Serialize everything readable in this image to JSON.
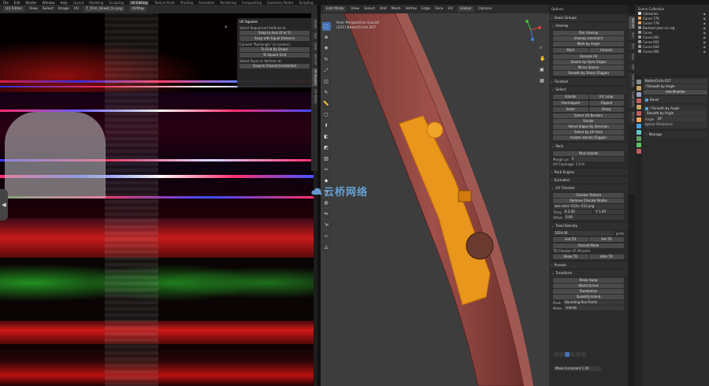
{
  "topbar": {
    "menu": [
      "File",
      "Edit",
      "Render",
      "Window",
      "Help"
    ],
    "workspaces": [
      "Layout",
      "Modeling",
      "Sculpting",
      "UV Editing",
      "Texture Paint",
      "Shading",
      "Animation",
      "Rendering",
      "Compositing",
      "Geometry Nodes",
      "Scripting"
    ],
    "active_workspace": "UV Editing"
  },
  "uv_editor": {
    "header": [
      "UV Editor",
      "View",
      "Select",
      "Image",
      "UV"
    ],
    "image_name": "T_Trim_Sheet_ts.png",
    "uvmap": "UVMap",
    "vertical_tabs": [
      "Image",
      "Tool",
      "View",
      "Zen UV",
      "UV Squares",
      "UV Toolkit"
    ],
    "active_tab": "UV Squares",
    "panel": {
      "title": "UV Squares",
      "sequential_label": "Select Sequenced Vertices to:",
      "snap_axis": "Snap to Axis (X or Y)",
      "snap_equal": "Snap with Equal Distance",
      "convert_label": "Convert \"Rectangle\" (4 corners):",
      "to_grid": "To Grid By Shape",
      "to_square": "To Square Grid",
      "faces_label": "Select Faces or Vertices to:",
      "snap_closest": "Snap to Closest Unselected"
    }
  },
  "viewport": {
    "header": [
      "Edit Mode",
      "View",
      "Select",
      "Add",
      "Mesh",
      "Vertex",
      "Edge",
      "Face",
      "UV"
    ],
    "transform": "Global",
    "options": "Options",
    "info_line1": "User Perspective (Local)",
    "info_line2": "(221) BezierCircle.027"
  },
  "watermark": "云桥网络",
  "zen_panel": {
    "seam_groups": "Seam Groups",
    "unwrap": "Unwrap",
    "zen_unwrap": "Zen Unwrap",
    "unwrap_constraint": "Unwrap constraint",
    "mark_by_angle": "Mark by Angle",
    "mark": "Mark",
    "unmark": "Unmark",
    "unmark_all": "Unmark All",
    "seams_by": "Seams by Open Edges",
    "mirror_seams": "Mirror Seams",
    "smooth_by_sharp": "Smooth by Sharp (Toggle)",
    "finished": "Finished",
    "select": "Select",
    "islands": "Islands",
    "int_loop": "Int. Loop",
    "overlapped": "Overlapped",
    "flipped": "Flipped",
    "seam": "Seam",
    "sharp": "Sharp",
    "select_uv_borders": "Select UV Borders",
    "similar": "Similar",
    "select_edges_dir": "Select Edges By Direction",
    "select_by_uv_area": "Select by UV Area",
    "isolate_islands": "Isolate Islands (Toggle)",
    "pack": "Pack",
    "pack_islands": "Pack Islands",
    "margin_label": "Margin px",
    "margin_value": "5",
    "uv_coverage": "UV Coverage: 1.0 %",
    "pack_engine": "Pack Engine",
    "excluded": "Excluded",
    "uv_checker": "UV Checker",
    "checker_texture": "Checker Texture",
    "remove_checker": "Remove Checker Nodes",
    "checker_image": "zen-color--512x--512.png",
    "tiling_label": "Tiling",
    "tiling_x": "X  2.00",
    "tiling_y": "Y  1.00",
    "offset_label": "Offset",
    "offset_value": "0.00",
    "texel_density": "Texel Density",
    "td_value": "1024.00",
    "td_unit": "px/m",
    "get_td": "Get TD",
    "set_td": "Set TD",
    "overall_mode": "Overall Mode",
    "td_checker": "TD Checker 47.59 px/m",
    "show_td": "Show TD",
    "hide_td": "Hide TD",
    "presets": "Presets",
    "transform": "Transform",
    "relax_swap": "Relax Swap",
    "world_orient": "World Orient",
    "randomize": "Randomize",
    "quadrify": "Quadrify Island",
    "pivot_label": "Pivot:",
    "pivot_value": "Bounding Box Points",
    "mode_label": "Mode:",
    "mode_value": "Islands",
    "move_increment": "Move Increment",
    "move_value": "1.00"
  },
  "n_tabs": [
    "Zen UV",
    "Item",
    "Tool",
    "View",
    "Edit",
    "Hard Ops",
    "Sculpt Tools",
    "Zen UV"
  ],
  "outliner": {
    "title": "Scene Collection",
    "items": [
      {
        "name": "Collection",
        "color": "#e0e0e0"
      },
      {
        "name": "Curve.776",
        "color": "#f2a65a"
      },
      {
        "name": "Curve.778",
        "color": "#f2a65a"
      },
      {
        "name": "Backout plan v1.svg",
        "color": "#9a9a9a"
      },
      {
        "name": "Curve",
        "color": "#9a9a9a"
      },
      {
        "name": "Curve.001",
        "color": "#9a9a9a"
      },
      {
        "name": "Curve.002",
        "color": "#9a9a9a"
      },
      {
        "name": "Curve.003",
        "color": "#9a9a9a"
      },
      {
        "name": "Curve.004",
        "color": "#9a9a9a"
      }
    ]
  },
  "properties": {
    "object": "BezierCircle.027",
    "modifier_target": "!!Smooth by Angle",
    "add_modifier": "Add Modifier",
    "bevel": "Bevel",
    "smooth_angle_mod": "!!Smooth by Angle",
    "smooth_by_angle": "Smooth by Angle",
    "angle_label": "Angle",
    "angle_value": "30°",
    "ignore_sharpness": "Ignore Sharpness",
    "manage": "Manage"
  },
  "colors": {
    "accent": "#4772b3",
    "mesh_selected": "#f5a623",
    "wood": "#a0504a"
  }
}
